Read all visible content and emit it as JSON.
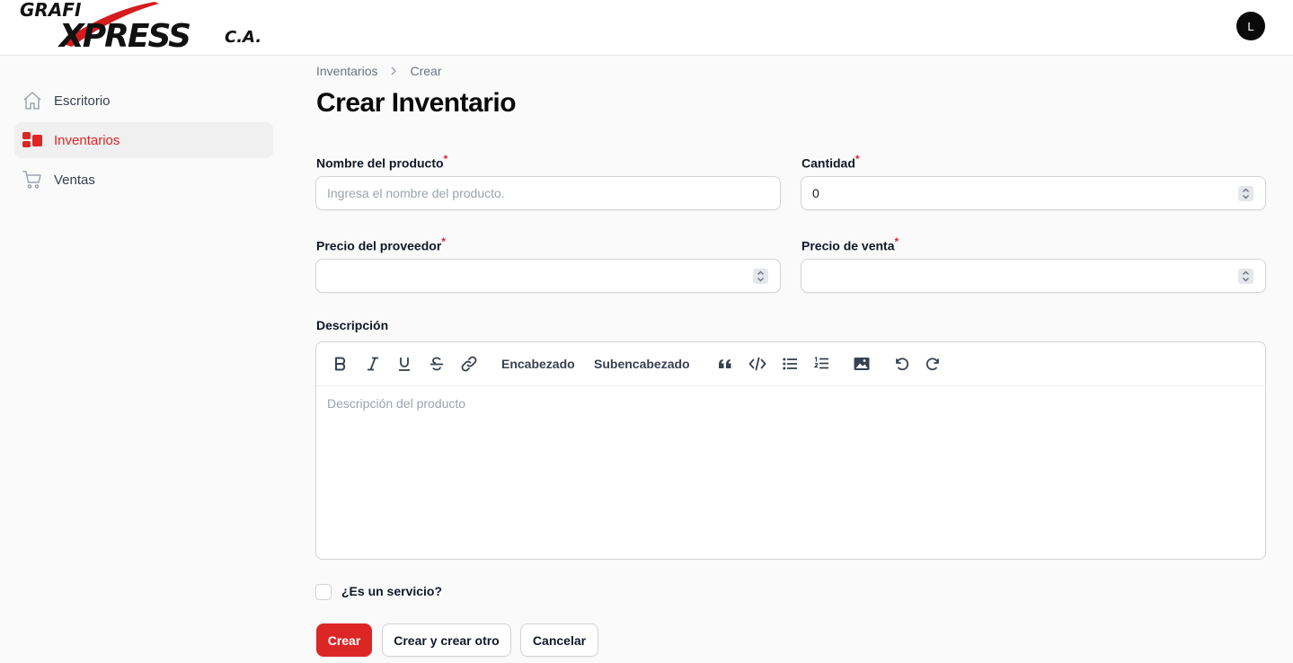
{
  "header": {
    "logo": {
      "line1": "GRAFI",
      "line2": "XPRESS",
      "suffix": "C.A."
    },
    "avatar_initial": "L"
  },
  "sidebar": {
    "items": [
      {
        "label": "Escritorio",
        "icon": "home-icon",
        "active": false
      },
      {
        "label": "Inventarios",
        "icon": "inventory-icon",
        "active": true
      },
      {
        "label": "Ventas",
        "icon": "cart-icon",
        "active": false
      }
    ]
  },
  "breadcrumb": {
    "items": [
      "Inventarios",
      "Crear"
    ]
  },
  "page": {
    "title": "Crear Inventario"
  },
  "form": {
    "required_mark": "*",
    "product_name": {
      "label": "Nombre del producto",
      "placeholder": "Ingresa el nombre del producto.",
      "value": ""
    },
    "quantity": {
      "label": "Cantidad",
      "value": "0"
    },
    "supplier_price": {
      "label": "Precio del proveedor",
      "value": ""
    },
    "sale_price": {
      "label": "Precio de venta",
      "value": ""
    },
    "description": {
      "label": "Descripción",
      "placeholder": "Descripción del producto",
      "toolbar": {
        "heading": "Encabezado",
        "subheading": "Subencabezado",
        "tools": [
          "bold",
          "italic",
          "underline",
          "strikethrough",
          "link",
          "heading",
          "subheading",
          "blockquote",
          "code",
          "bullet-list",
          "ordered-list",
          "image",
          "undo",
          "redo"
        ]
      }
    },
    "is_service": {
      "label": "¿Es un servicio?",
      "checked": false
    }
  },
  "actions": {
    "create": "Crear",
    "create_another": "Crear y crear otro",
    "cancel": "Cancelar"
  },
  "colors": {
    "accent": "#dc2626",
    "background": "#fafafa",
    "border": "#d4d4d8",
    "text_muted": "#6b7280"
  }
}
